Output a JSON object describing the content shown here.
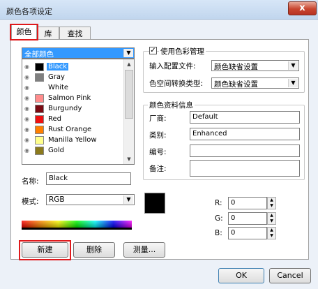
{
  "window": {
    "title": "颜色各项设定",
    "close": "x"
  },
  "tabs": [
    {
      "label": "颜色"
    },
    {
      "label": "库"
    },
    {
      "label": "查找"
    }
  ],
  "colorset": {
    "selected": "全部颜色"
  },
  "colors": [
    {
      "name": "Black",
      "hex": "#000000"
    },
    {
      "name": "Gray",
      "hex": "#7f7f7f"
    },
    {
      "name": "White",
      "hex": "#ffffff"
    },
    {
      "name": "Salmon Pink",
      "hex": "#ff8c8c"
    },
    {
      "name": "Burgundy",
      "hex": "#7a0a12"
    },
    {
      "name": "Red",
      "hex": "#ee1111"
    },
    {
      "name": "Rust Orange",
      "hex": "#ff7f00"
    },
    {
      "name": "Manilla Yellow",
      "hex": "#ffff8c"
    },
    {
      "name": "Gold",
      "hex": "#8c7a1c"
    }
  ],
  "color_mgmt": {
    "checkbox_label": "使用色彩管理",
    "checked": true,
    "input_profile_label": "输入配置文件:",
    "input_profile_value": "颜色缺省设置",
    "conversion_label": "色空间转换类型:",
    "conversion_value": "颜色缺省设置"
  },
  "info": {
    "title": "颜色资料信息",
    "vendor_label": "厂商:",
    "vendor_value": "Default",
    "category_label": "类别:",
    "category_value": "Enhanced",
    "number_label": "编号:",
    "number_value": "",
    "note_label": "备注:",
    "note_value": ""
  },
  "name_field": {
    "label": "名称:",
    "value": "Black"
  },
  "mode": {
    "label": "模式:",
    "value": "RGB"
  },
  "rgb": {
    "r_label": "R:",
    "r": "0",
    "g_label": "G:",
    "g": "0",
    "b_label": "B:",
    "b": "0"
  },
  "preview_color": "#000000",
  "buttons": {
    "new": "新建",
    "delete": "删除",
    "measure": "测量...",
    "ok": "OK",
    "cancel": "Cancel"
  }
}
